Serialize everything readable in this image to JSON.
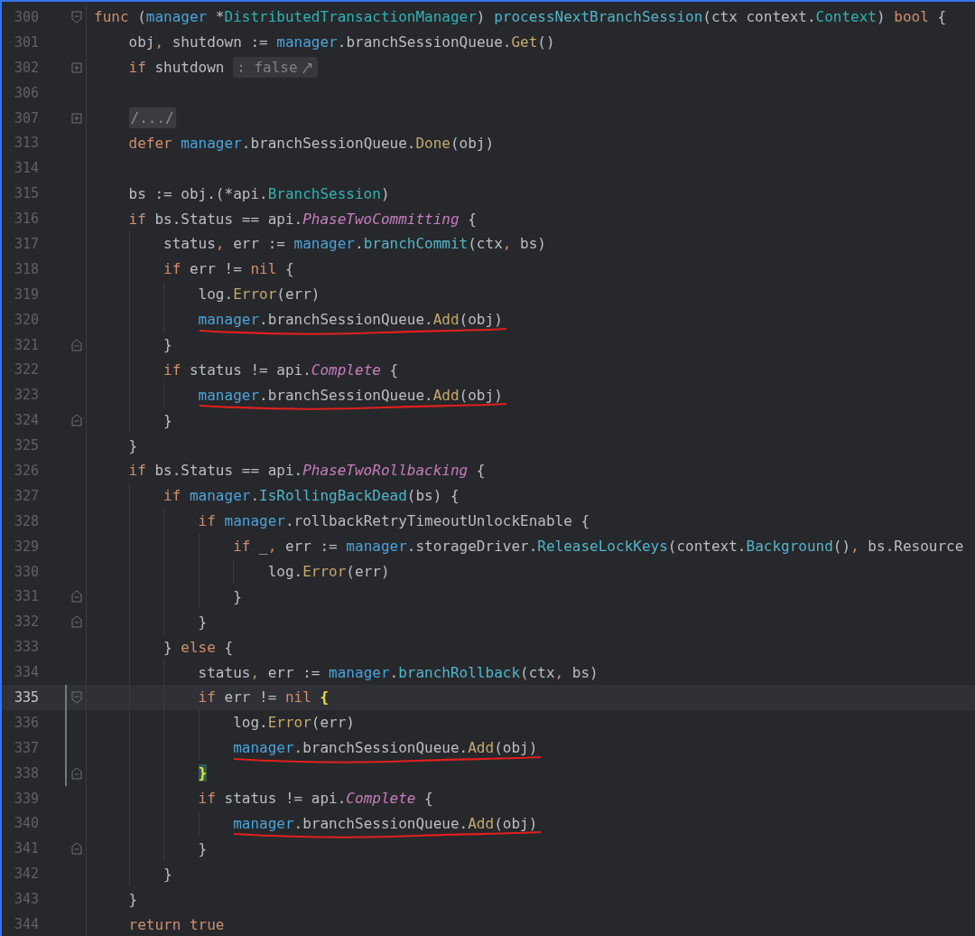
{
  "editor": {
    "lines": [
      {
        "number": "300",
        "foldStart": true,
        "tokens": [
          {
            "text": "func",
            "kind": "kw"
          },
          {
            "text": " (",
            "kind": "plain"
          },
          {
            "text": "manager",
            "kind": "var"
          },
          {
            "text": " *",
            "kind": "plain"
          },
          {
            "text": "DistributedTransactionManager",
            "kind": "type"
          },
          {
            "text": ") ",
            "kind": "plain"
          },
          {
            "text": "processNextBranchSession",
            "kind": "fn"
          },
          {
            "text": "(ctx context.",
            "kind": "plain"
          },
          {
            "text": "Context",
            "kind": "type"
          },
          {
            "text": ") ",
            "kind": "plain"
          },
          {
            "text": "bool",
            "kind": "kw"
          },
          {
            "text": " {",
            "kind": "plain"
          }
        ]
      },
      {
        "number": "301",
        "tokens": [
          {
            "text": "    obj",
            "kind": "plain"
          },
          {
            "text": ",",
            "kind": "kw"
          },
          {
            "text": " shutdown := ",
            "kind": "plain"
          },
          {
            "text": "manager",
            "kind": "var"
          },
          {
            "text": ".branchSessionQueue.",
            "kind": "plain"
          },
          {
            "text": "Get",
            "kind": "call"
          },
          {
            "text": "()",
            "kind": "plain"
          }
        ]
      },
      {
        "number": "302",
        "collapsed": true,
        "tokens": [
          {
            "text": "    if",
            "kind": "kw"
          },
          {
            "text": " shutdown ",
            "kind": "plain"
          },
          {
            "text": ": false",
            "kind": "hint"
          }
        ]
      },
      {
        "number": "306"
      },
      {
        "number": "307",
        "collapsed": true,
        "tokens": [
          {
            "text": "    /.../",
            "kind": "folded"
          }
        ]
      },
      {
        "number": "313",
        "tokens": [
          {
            "text": "    defer ",
            "kind": "kw"
          },
          {
            "text": "manager",
            "kind": "var"
          },
          {
            "text": ".branchSessionQueue.",
            "kind": "plain"
          },
          {
            "text": "Done",
            "kind": "call"
          },
          {
            "text": "(obj)",
            "kind": "plain"
          }
        ]
      },
      {
        "number": "314"
      },
      {
        "number": "315",
        "tokens": [
          {
            "text": "    bs := obj.(*api.",
            "kind": "plain"
          },
          {
            "text": "BranchSession",
            "kind": "type"
          },
          {
            "text": ")",
            "kind": "plain"
          }
        ]
      },
      {
        "number": "316",
        "tokens": [
          {
            "text": "    if",
            "kind": "kw"
          },
          {
            "text": " bs.Status == api.",
            "kind": "plain"
          },
          {
            "text": "PhaseTwoCommitting",
            "kind": "const"
          },
          {
            "text": " {",
            "kind": "plain"
          }
        ]
      },
      {
        "number": "317",
        "tokens": [
          {
            "text": "        status",
            "kind": "plain"
          },
          {
            "text": ",",
            "kind": "kw"
          },
          {
            "text": " err := ",
            "kind": "plain"
          },
          {
            "text": "manager",
            "kind": "var"
          },
          {
            "text": ".",
            "kind": "plain"
          },
          {
            "text": "branchCommit",
            "kind": "fn"
          },
          {
            "text": "(ctx",
            "kind": "plain"
          },
          {
            "text": ",",
            "kind": "kw"
          },
          {
            "text": " bs)",
            "kind": "plain"
          }
        ]
      },
      {
        "number": "318",
        "tokens": [
          {
            "text": "        if",
            "kind": "kw"
          },
          {
            "text": " err != ",
            "kind": "plain"
          },
          {
            "text": "nil",
            "kind": "kw"
          },
          {
            "text": " {",
            "kind": "plain"
          }
        ]
      },
      {
        "number": "319",
        "tokens": [
          {
            "text": "            log.",
            "kind": "plain"
          },
          {
            "text": "Error",
            "kind": "call"
          },
          {
            "text": "(err)",
            "kind": "plain"
          }
        ]
      },
      {
        "number": "320",
        "underlined": true,
        "tokens": [
          {
            "text": "            manager",
            "kind": "var"
          },
          {
            "text": ".branchSessionQueue.",
            "kind": "plain"
          },
          {
            "text": "Add",
            "kind": "call"
          },
          {
            "text": "(obj)",
            "kind": "plain"
          }
        ]
      },
      {
        "number": "321",
        "foldEnd": true,
        "tokens": [
          {
            "text": "        }",
            "kind": "plain"
          }
        ]
      },
      {
        "number": "322",
        "tokens": [
          {
            "text": "        if",
            "kind": "kw"
          },
          {
            "text": " status != api.",
            "kind": "plain"
          },
          {
            "text": "Complete",
            "kind": "const"
          },
          {
            "text": " {",
            "kind": "plain"
          }
        ]
      },
      {
        "number": "323",
        "underlined": true,
        "tokens": [
          {
            "text": "            manager",
            "kind": "var"
          },
          {
            "text": ".branchSessionQueue.",
            "kind": "plain"
          },
          {
            "text": "Add",
            "kind": "call"
          },
          {
            "text": "(obj)",
            "kind": "plain"
          }
        ]
      },
      {
        "number": "324",
        "foldEnd": true,
        "tokens": [
          {
            "text": "        }",
            "kind": "plain"
          }
        ]
      },
      {
        "number": "325",
        "tokens": [
          {
            "text": "    }",
            "kind": "plain"
          }
        ]
      },
      {
        "number": "326",
        "tokens": [
          {
            "text": "    if",
            "kind": "kw"
          },
          {
            "text": " bs.Status == api.",
            "kind": "plain"
          },
          {
            "text": "PhaseTwoRollbacking",
            "kind": "const"
          },
          {
            "text": " {",
            "kind": "plain"
          }
        ]
      },
      {
        "number": "327",
        "tokens": [
          {
            "text": "        if ",
            "kind": "kw"
          },
          {
            "text": "manager",
            "kind": "var"
          },
          {
            "text": ".",
            "kind": "plain"
          },
          {
            "text": "IsRollingBackDead",
            "kind": "fn"
          },
          {
            "text": "(bs) {",
            "kind": "plain"
          }
        ]
      },
      {
        "number": "328",
        "tokens": [
          {
            "text": "            if ",
            "kind": "kw"
          },
          {
            "text": "manager",
            "kind": "var"
          },
          {
            "text": ".rollbackRetryTimeoutUnlockEnable {",
            "kind": "plain"
          }
        ]
      },
      {
        "number": "329",
        "tokens": [
          {
            "text": "                if",
            "kind": "kw"
          },
          {
            "text": " _",
            "kind": "plain"
          },
          {
            "text": ",",
            "kind": "kw"
          },
          {
            "text": " err := ",
            "kind": "plain"
          },
          {
            "text": "manager",
            "kind": "var"
          },
          {
            "text": ".storageDriver.",
            "kind": "plain"
          },
          {
            "text": "ReleaseLockKeys",
            "kind": "fn"
          },
          {
            "text": "(context.",
            "kind": "plain"
          },
          {
            "text": "Background",
            "kind": "fn"
          },
          {
            "text": "()",
            "kind": "plain"
          },
          {
            "text": ",",
            "kind": "kw"
          },
          {
            "text": " bs.Resource",
            "kind": "plain"
          }
        ]
      },
      {
        "number": "330",
        "tokens": [
          {
            "text": "                    log.",
            "kind": "plain"
          },
          {
            "text": "Error",
            "kind": "call"
          },
          {
            "text": "(err)",
            "kind": "plain"
          }
        ]
      },
      {
        "number": "331",
        "foldEnd": true,
        "tokens": [
          {
            "text": "                }",
            "kind": "plain"
          }
        ]
      },
      {
        "number": "332",
        "foldEnd": true,
        "tokens": [
          {
            "text": "            }",
            "kind": "plain"
          }
        ]
      },
      {
        "number": "333",
        "tokens": [
          {
            "text": "        } ",
            "kind": "plain"
          },
          {
            "text": "else",
            "kind": "kw"
          },
          {
            "text": " {",
            "kind": "plain"
          }
        ]
      },
      {
        "number": "334",
        "tokens": [
          {
            "text": "            status",
            "kind": "plain"
          },
          {
            "text": ",",
            "kind": "kw"
          },
          {
            "text": " err := ",
            "kind": "plain"
          },
          {
            "text": "manager",
            "kind": "var"
          },
          {
            "text": ".",
            "kind": "plain"
          },
          {
            "text": "branchRollback",
            "kind": "fn"
          },
          {
            "text": "(ctx",
            "kind": "plain"
          },
          {
            "text": ",",
            "kind": "kw"
          },
          {
            "text": " bs)",
            "kind": "plain"
          }
        ]
      },
      {
        "number": "335",
        "current": true,
        "modified": true,
        "foldStart": true,
        "tokens": [
          {
            "text": "            if",
            "kind": "kw"
          },
          {
            "text": " err != ",
            "kind": "plain"
          },
          {
            "text": "nil ",
            "kind": "kw"
          },
          {
            "text": "{",
            "kind": "brace"
          }
        ]
      },
      {
        "number": "336",
        "modified": true,
        "tokens": [
          {
            "text": "                log.",
            "kind": "plain"
          },
          {
            "text": "Error",
            "kind": "call"
          },
          {
            "text": "(err)",
            "kind": "plain"
          }
        ]
      },
      {
        "number": "337",
        "modified": true,
        "underlined": true,
        "tokens": [
          {
            "text": "                manager",
            "kind": "var"
          },
          {
            "text": ".branchSessionQueue.",
            "kind": "plain"
          },
          {
            "text": "Add",
            "kind": "call"
          },
          {
            "text": "(obj)",
            "kind": "plain"
          }
        ]
      },
      {
        "number": "338",
        "modified": true,
        "foldEnd": true,
        "tokens": [
          {
            "text": "            }",
            "kind": "matched"
          }
        ]
      },
      {
        "number": "339",
        "tokens": [
          {
            "text": "            if",
            "kind": "kw"
          },
          {
            "text": " status != api.",
            "kind": "plain"
          },
          {
            "text": "Complete",
            "kind": "const"
          },
          {
            "text": " {",
            "kind": "plain"
          }
        ]
      },
      {
        "number": "340",
        "underlined": true,
        "tokens": [
          {
            "text": "                manager",
            "kind": "var"
          },
          {
            "text": ".branchSessionQueue.",
            "kind": "plain"
          },
          {
            "text": "Add",
            "kind": "call"
          },
          {
            "text": "(obj)",
            "kind": "plain"
          }
        ]
      },
      {
        "number": "341",
        "foldEnd": true,
        "tokens": [
          {
            "text": "            }",
            "kind": "plain"
          }
        ]
      },
      {
        "number": "342",
        "tokens": [
          {
            "text": "        }",
            "kind": "plain"
          }
        ]
      },
      {
        "number": "343",
        "tokens": [
          {
            "text": "    }",
            "kind": "plain"
          }
        ]
      },
      {
        "number": "344",
        "tokens": [
          {
            "text": "    return ",
            "kind": "kw"
          },
          {
            "text": "true",
            "kind": "kw"
          }
        ]
      }
    ]
  }
}
